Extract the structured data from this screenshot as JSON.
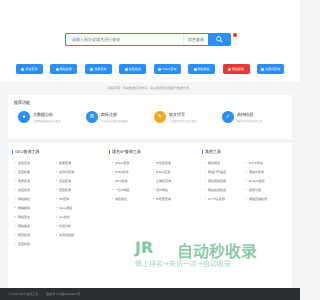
{
  "search": {
    "placeholder": "请输入网址或域名进行查询",
    "type_label": "综合查询"
  },
  "nav": [
    {
      "label": "综合查询",
      "color": "#2b8ff7"
    },
    {
      "label": "网站权重",
      "color": "#2b8ff7"
    },
    {
      "label": "权重查询",
      "color": "#2b8ff7"
    },
    {
      "label": "友链检测",
      "color": "#2b8ff7"
    },
    {
      "label": "Whois查询",
      "color": "#2b8ff7"
    },
    {
      "label": "网站测速",
      "color": "#2b8ff7"
    },
    {
      "label": "网站备案",
      "color": "#e53935"
    },
    {
      "label": "关键词查询",
      "color": "#2b8ff7"
    }
  ],
  "notice": "特别声明：本站数据仅供参考，请以各搜索引擎官方数据为准。",
  "recommended": {
    "title": "推荐功能",
    "items": [
      {
        "name": "大数据分析",
        "desc": "全网网站数据分析与查询",
        "icon": "chart-icon",
        "glyph": "●",
        "color": "#2b8ff7"
      },
      {
        "name": "商标注册",
        "desc": "专业商标注册与查询服务",
        "icon": "trademark-icon",
        "glyph": "R",
        "color": "#2b8ff7"
      },
      {
        "name": "软文代写",
        "desc": "专业软文写作与推广服务",
        "icon": "pen-icon",
        "glyph": "✎",
        "color": "#f5a623"
      },
      {
        "name": "劫持检测",
        "desc": "网站DNS劫持检测工具",
        "icon": "shield-icon",
        "glyph": "✓",
        "color": "#2b8ff7"
      }
    ]
  },
  "sections": [
    {
      "title": "SEO查询工具",
      "items": [
        "综合查询",
        "权重查询",
        "百度权重",
        "关键词查询",
        "收录查询",
        "反链查询",
        "友链检测",
        "死链检测",
        "网站排名",
        "PR查询",
        "蜘蛛模拟",
        "Alexa排名",
        "网站安全",
        "seo综合",
        "网站备案",
        "外链分析",
        "网页检测",
        "关键词挖掘",
        "百度外链"
      ]
    },
    {
      "title": "域名/IP查询工具",
      "items": [
        "Whois查询",
        "IP位置查询",
        "PING检测",
        "Whois反查",
        "DNS查询",
        "子域名查询",
        "一亿IP域名",
        "同IP网站",
        "域名信息",
        "IP批量查询"
      ]
    },
    {
      "title": "其他工具",
      "items": [
        "网站测速",
        "HTTP状态",
        "网站打开速度",
        "网站IP查询",
        "网站源码查看",
        "Robots检测",
        "网站在线状态",
        "搜索引擎",
        "HTTP头检测",
        "网站压缩检测"
      ]
    }
  ],
  "watermark": {
    "logo": "JR",
    "title": "自动秒收录",
    "sub": "做上排名→来访一次→自动收录"
  },
  "footer": {
    "copyright": "© 2019-2023 站长工具",
    "icp": "备案号 ICP备20230001号"
  }
}
